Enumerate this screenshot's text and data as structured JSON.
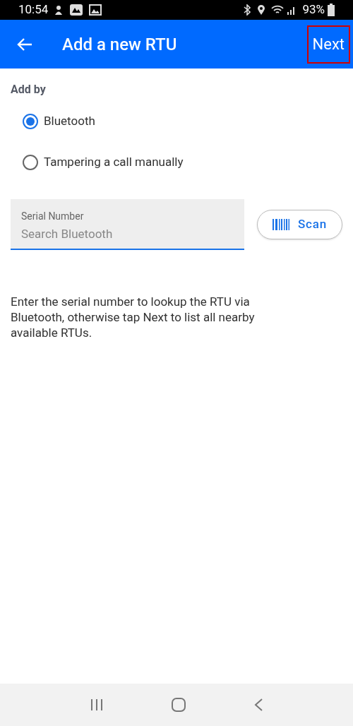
{
  "status_bar": {
    "time": "10:54",
    "battery": "93%"
  },
  "app_bar": {
    "title": "Add a new RTU",
    "action": {
      "label": "Next",
      "highlighted": true
    }
  },
  "section_label": "Add by",
  "options": [
    {
      "label": "Bluetooth",
      "selected": true
    },
    {
      "label": "Tampering a call manually",
      "selected": false
    }
  ],
  "serial_field": {
    "label": "Serial Number",
    "placeholder": "Search Bluetooth",
    "focused": true
  },
  "scan_button": {
    "label": "Scan"
  },
  "help_text": "Enter the serial number to lookup the RTU via Bluetooth, otherwise tap Next to list all nearby available RTUs."
}
